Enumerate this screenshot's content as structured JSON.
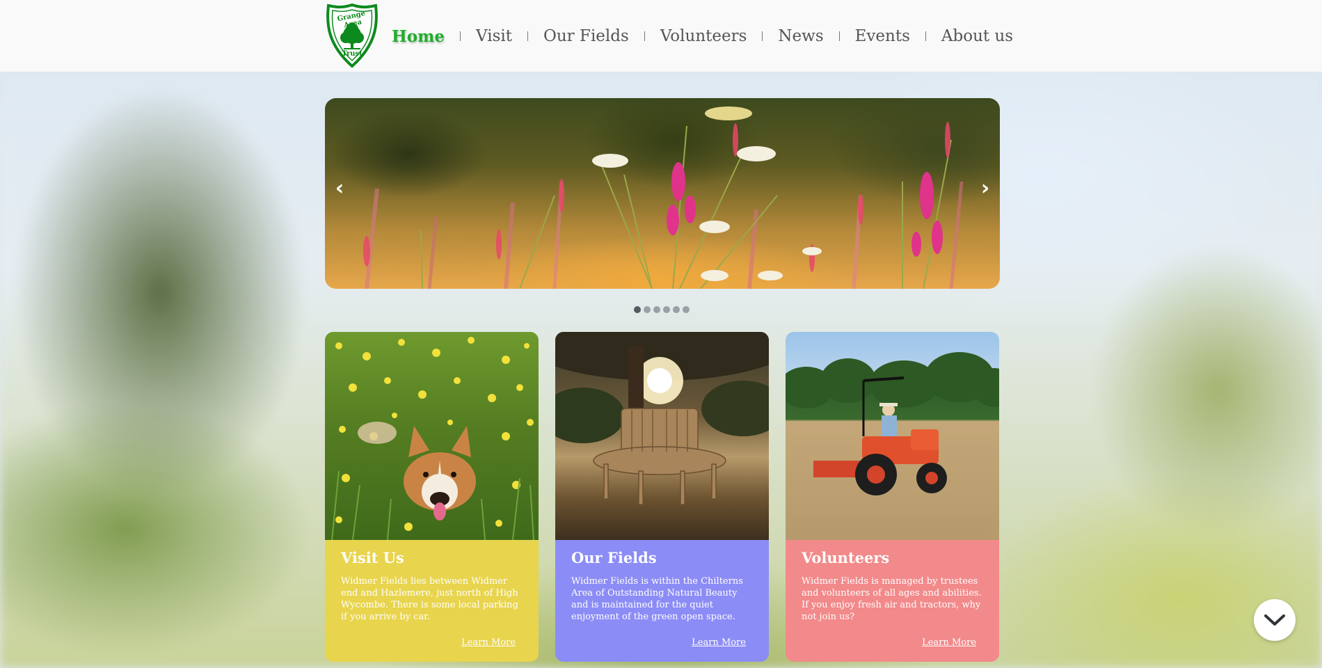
{
  "header": {
    "logo": {
      "text_top": "Grange Area",
      "text_bottom": "Trust",
      "icon": "tree-icon",
      "color": "#0d8a1e"
    },
    "nav": [
      {
        "label": "Home",
        "active": true
      },
      {
        "label": "Visit",
        "active": false
      },
      {
        "label": "Our Fields",
        "active": false
      },
      {
        "label": "Volunteers",
        "active": false
      },
      {
        "label": "News",
        "active": false
      },
      {
        "label": "Events",
        "active": false
      },
      {
        "label": "About us",
        "active": false
      }
    ],
    "active_color": "#1fae2a"
  },
  "slider": {
    "prev_icon": "‹",
    "next_icon": "›",
    "slide_count": 6,
    "active_slide": 1,
    "image": "wildflowers-meadow"
  },
  "cards": [
    {
      "title": "Visit Us",
      "text": "Widmer Fields lies between Widmer end and Hazlemere, just north of High Wycombe. There is some local parking if you arrive by car.",
      "link": "Learn More",
      "color": "#e8d44d",
      "image": "corgi-in-buttercups"
    },
    {
      "title": "Our Fields",
      "text": "Widmer Fields is within the Chilterns Area of Outstanding Natural Beauty and is maintained for the quiet enjoyment of the green open space.",
      "link": "Learn More",
      "color": "#8c8cf6",
      "image": "tree-bench-sunset"
    },
    {
      "title": "Volunteers",
      "text": "Widmer Fields is managed by trustees and volunteers of all ages and abilities. If you enjoy fresh air and tractors, why not join us?",
      "link": "Learn More",
      "color": "#f2898a",
      "image": "red-tractor-mowing"
    }
  ],
  "scroll_button": {
    "icon": "chevron-down-icon"
  }
}
